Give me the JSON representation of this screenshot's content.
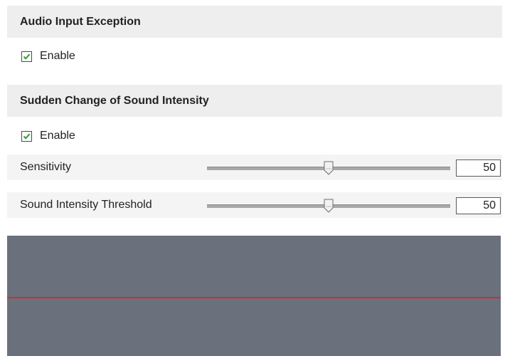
{
  "audio_input_exception": {
    "title": "Audio Input Exception",
    "enable_label": "Enable",
    "enabled": true
  },
  "sudden_change": {
    "title": "Sudden Change of Sound Intensity",
    "enable_label": "Enable",
    "enabled": true
  },
  "params": {
    "sensitivity": {
      "label": "Sensitivity",
      "value": "50",
      "slider_fraction": 0.5
    },
    "threshold": {
      "label": "Sound Intensity Threshold",
      "value": "50",
      "slider_fraction": 0.5
    }
  },
  "colors": {
    "header_bg": "#eeeeee",
    "row_bg": "#f4f4f4",
    "check_color": "#2f9e2f",
    "graph_bg": "#6a717c",
    "graph_line": "#e0262a"
  },
  "icons": {
    "checkbox_checked": "checkmark-icon",
    "slider_handle": "slider-thumb-icon"
  }
}
